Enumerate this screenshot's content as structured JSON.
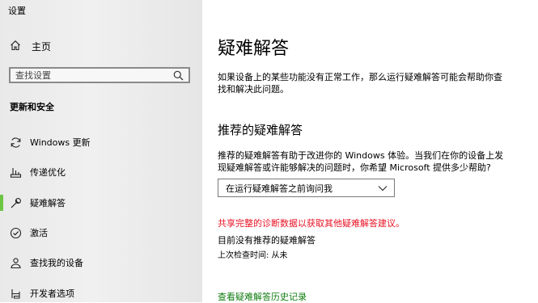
{
  "window": {
    "title": "设置"
  },
  "sidebar": {
    "home_label": "主页",
    "search_placeholder": "查找设置",
    "section_title": "更新和安全",
    "items": [
      {
        "label": "Windows 更新",
        "icon": "sync-icon"
      },
      {
        "label": "传递优化",
        "icon": "delivery-optimization-icon"
      },
      {
        "label": "疑难解答",
        "icon": "wrench-icon",
        "selected": true
      },
      {
        "label": "激活",
        "icon": "activation-check-icon"
      },
      {
        "label": "查找我的设备",
        "icon": "find-device-icon"
      },
      {
        "label": "开发者选项",
        "icon": "developer-icon"
      }
    ],
    "accent_color": "#6cc644"
  },
  "main": {
    "title": "疑难解答",
    "intro_line1": "如果设备上的某些功能没有正常工作，那么运行疑难解答可能会帮助你查",
    "intro_line2": "找和解决此问题。",
    "recommended_heading": "推荐的疑难解答",
    "recommended_desc_line1": "推荐的疑难解答有助于改进你的 Windows 体验。当我们在你的设备上发",
    "recommended_desc_line2": "现疑难解答或许能够解决的问题时，你希望 Microsoft 提供多少帮助?",
    "dropdown_value": "在运行疑难解答之前询问我",
    "warning": "共享完整的诊断数据以获取其他疑难解答建议。",
    "warning_color": "#e81123",
    "no_recommendations": "目前没有推荐的疑难解答",
    "last_checked": "上次检查时间: 从未",
    "history_link": "查看疑难解答历史记录",
    "link_color": "#107c10"
  }
}
